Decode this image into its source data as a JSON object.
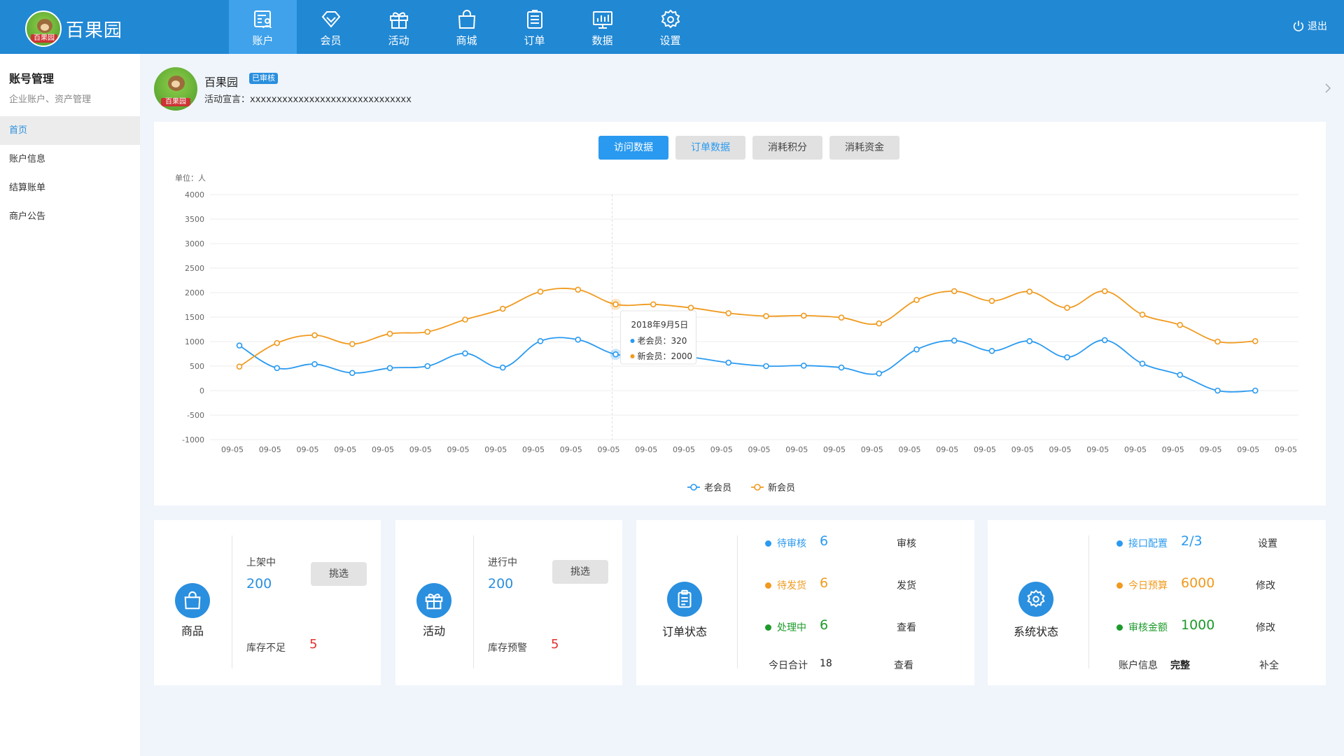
{
  "brand": {
    "title": "百果园",
    "logo_text": "百果园"
  },
  "nav": [
    {
      "label": "账户",
      "icon": "account-icon",
      "active": true
    },
    {
      "label": "会员",
      "icon": "diamond-icon",
      "active": false
    },
    {
      "label": "活动",
      "icon": "gift-icon",
      "active": false
    },
    {
      "label": "商城",
      "icon": "bag-icon",
      "active": false
    },
    {
      "label": "订单",
      "icon": "order-list-icon",
      "active": false
    },
    {
      "label": "数据",
      "icon": "monitor-chart-icon",
      "active": false
    },
    {
      "label": "设置",
      "icon": "gear-icon",
      "active": false
    }
  ],
  "logout": {
    "label": "退出",
    "icon": "power-icon"
  },
  "sidebar": {
    "title": "账号管理",
    "subtitle": "企业账户、资产管理",
    "items": [
      {
        "label": "首页",
        "active": true
      },
      {
        "label": "账户信息",
        "active": false
      },
      {
        "label": "结算账单",
        "active": false
      },
      {
        "label": "商户公告",
        "active": false
      }
    ]
  },
  "profile": {
    "name": "百果园",
    "badge": "已审核",
    "motto": "活动宣言：xxxxxxxxxxxxxxxxxxxxxxxxxxxxxx",
    "avatar_text": "百果园"
  },
  "chart_tabs": [
    {
      "label": "访问数据",
      "state": "active"
    },
    {
      "label": "订单数据",
      "state": "hover"
    },
    {
      "label": "消耗积分",
      "state": "normal"
    },
    {
      "label": "消耗资金",
      "state": "normal"
    }
  ],
  "chart_data": {
    "type": "line",
    "unit_label": "单位：人",
    "ylim": [
      -1000,
      4000
    ],
    "yticks": [
      4000,
      3500,
      3000,
      2500,
      2000,
      1500,
      1000,
      500,
      0,
      -500,
      -1000
    ],
    "categories": [
      "09-05",
      "09-05",
      "09-05",
      "09-05",
      "09-05",
      "09-05",
      "09-05",
      "09-05",
      "09-05",
      "09-05",
      "09-05",
      "09-05",
      "09-05",
      "09-05",
      "09-05",
      "09-05",
      "09-05",
      "09-05",
      "09-05",
      "09-05",
      "09-05",
      "09-05",
      "09-05",
      "09-05",
      "09-05",
      "09-05",
      "09-05",
      "09-05",
      "09-05"
    ],
    "series": [
      {
        "name": "老会员",
        "color": "#2a9af0",
        "values": [
          920,
          460,
          540,
          360,
          460,
          500,
          760,
          470,
          1010,
          1040,
          740,
          720,
          680,
          570,
          500,
          510,
          470,
          350,
          840,
          1020,
          810,
          1010,
          680,
          1030,
          550,
          320,
          0,
          0
        ]
      },
      {
        "name": "新会员",
        "color": "#f09a1e",
        "values": [
          490,
          970,
          1130,
          950,
          1160,
          1200,
          1450,
          1670,
          2020,
          2060,
          1760,
          1760,
          1690,
          1580,
          1520,
          1530,
          1490,
          1370,
          1850,
          2030,
          1830,
          2020,
          1690,
          2030,
          1550,
          1340,
          1000,
          1010
        ]
      }
    ],
    "grid": true,
    "legend": "bottom-center",
    "tooltip": {
      "index": 10,
      "title": "2018年9月5日",
      "rows": [
        {
          "label": "老会员：320",
          "color": "#2a9af0"
        },
        {
          "label": "新会员：2000",
          "color": "#f09a1e"
        }
      ]
    }
  },
  "cards": {
    "goods": {
      "name": "商品",
      "icon": "bag-icon",
      "on_label": "上架中",
      "on_value": "200",
      "button": "挑选",
      "low_label": "库存不足",
      "low_value": "5"
    },
    "activity": {
      "name": "活动",
      "icon": "gift-icon",
      "on_label": "进行中",
      "on_value": "200",
      "button": "挑选",
      "low_label": "库存预警",
      "low_value": "5"
    },
    "orders": {
      "name": "订单状态",
      "icon": "clipboard-icon",
      "rows": [
        {
          "label": "待审核",
          "value": "6",
          "action": "审核",
          "color": "#2a9af0"
        },
        {
          "label": "待发货",
          "value": "6",
          "action": "发货",
          "color": "#f09a1e"
        },
        {
          "label": "处理中",
          "value": "6",
          "action": "查看",
          "color": "#1c9a2a"
        }
      ],
      "total_label": "今日合计",
      "total_value": "18",
      "total_action": "查看"
    },
    "system": {
      "name": "系统状态",
      "icon": "gear-icon",
      "rows": [
        {
          "label": "接口配置",
          "value": "2/3",
          "action": "设置",
          "color": "#2a9af0"
        },
        {
          "label": "今日预算",
          "value": "6000",
          "action": "修改",
          "color": "#f09a1e"
        },
        {
          "label": "审核金额",
          "value": "1000",
          "action": "修改",
          "color": "#1c9a2a"
        }
      ],
      "info_label": "账户信息",
      "info_value": "完整",
      "info_action": "补全"
    }
  }
}
